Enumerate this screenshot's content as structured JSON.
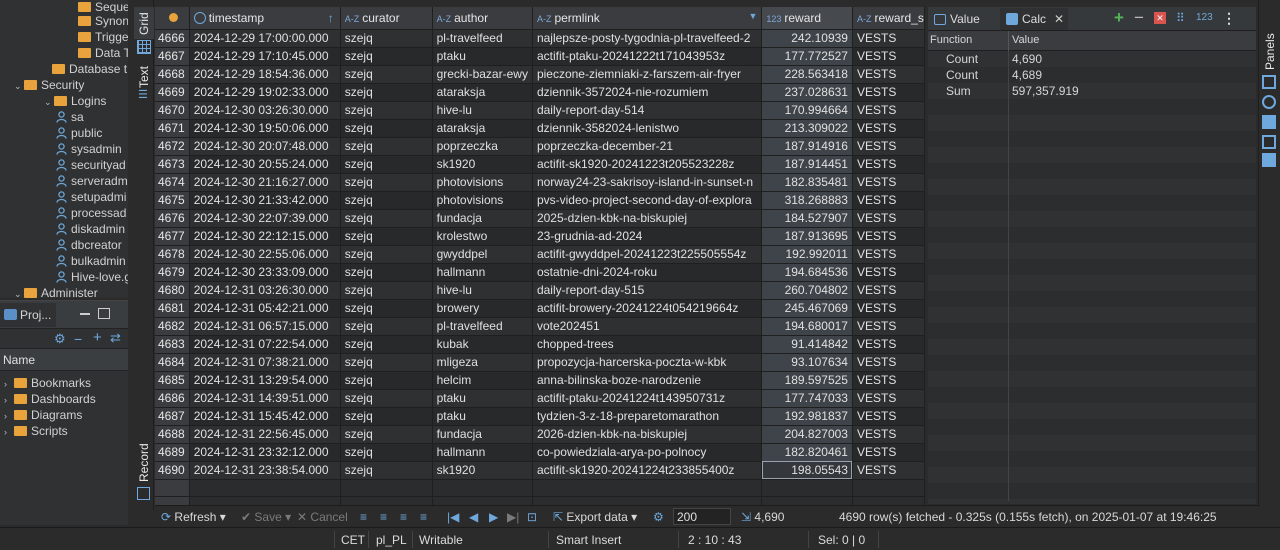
{
  "nav_tree": {
    "items": [
      {
        "label": "Seque",
        "level": 3,
        "type": "folder"
      },
      {
        "label": "Synon",
        "level": 3,
        "type": "folder"
      },
      {
        "label": "Trigge",
        "level": 3,
        "type": "folder"
      },
      {
        "label": "Data T",
        "level": 3,
        "type": "folder"
      },
      {
        "label": "Database t",
        "level": 2,
        "type": "folder"
      },
      {
        "label": "Security",
        "level": 1,
        "type": "folder",
        "expanded": true
      },
      {
        "label": "Logins",
        "level": 2,
        "type": "folder",
        "expanded": true
      },
      {
        "label": "sa",
        "level": 3,
        "type": "user"
      },
      {
        "label": "public",
        "level": 3,
        "type": "user"
      },
      {
        "label": "sysadmin",
        "level": 3,
        "type": "user"
      },
      {
        "label": "securityad",
        "level": 3,
        "type": "user"
      },
      {
        "label": "serveradm",
        "level": 3,
        "type": "user"
      },
      {
        "label": "setupadmi",
        "level": 3,
        "type": "user"
      },
      {
        "label": "processad",
        "level": 3,
        "type": "user"
      },
      {
        "label": "diskadmin",
        "level": 3,
        "type": "user"
      },
      {
        "label": "dbcreator",
        "level": 3,
        "type": "user"
      },
      {
        "label": "bulkadmin",
        "level": 3,
        "type": "user"
      },
      {
        "label": "Hive-love.g",
        "level": 3,
        "type": "user"
      },
      {
        "label": "Administer",
        "level": 1,
        "type": "folder",
        "expanded": true
      }
    ]
  },
  "projects_panel": {
    "tab_label": "Proj...",
    "column_header": "Name",
    "items": [
      "Bookmarks",
      "Dashboards",
      "Diagrams",
      "Scripts"
    ]
  },
  "view_tabs": {
    "grid": "Grid",
    "text": "Text",
    "record": "Record"
  },
  "grid": {
    "columns": [
      {
        "label": "timestamp",
        "type": "time"
      },
      {
        "label": "curator",
        "type": "A-Z"
      },
      {
        "label": "author",
        "type": "A-Z"
      },
      {
        "label": "permlink",
        "type": "A-Z"
      },
      {
        "label": "reward",
        "type": "123"
      },
      {
        "label": "reward_s",
        "type": "A-Z"
      }
    ],
    "type_tag_text": "A-Z",
    "numeric_tag_text": "123",
    "rows": [
      [
        "4666",
        "2024-12-29 17:00:00.000",
        "szejq",
        "pl-travelfeed",
        "najlepsze-posty-tygodnia-pl-travelfeed-2",
        "242.10939",
        "VESTS"
      ],
      [
        "4667",
        "2024-12-29 17:10:45.000",
        "szejq",
        "ptaku",
        "actifit-ptaku-20241222t171043953z",
        "177.772527",
        "VESTS"
      ],
      [
        "4668",
        "2024-12-29 18:54:36.000",
        "szejq",
        "grecki-bazar-ewy",
        "pieczone-ziemniaki-z-farszem-air-fryer",
        "228.563418",
        "VESTS"
      ],
      [
        "4669",
        "2024-12-29 19:02:33.000",
        "szejq",
        "ataraksja",
        "dziennik-3572024-nie-rozumiem",
        "237.028631",
        "VESTS"
      ],
      [
        "4670",
        "2024-12-30 03:26:30.000",
        "szejq",
        "hive-lu",
        "daily-report-day-514",
        "170.994664",
        "VESTS"
      ],
      [
        "4671",
        "2024-12-30 19:50:06.000",
        "szejq",
        "ataraksja",
        "dziennik-3582024-lenistwo",
        "213.309022",
        "VESTS"
      ],
      [
        "4672",
        "2024-12-30 20:07:48.000",
        "szejq",
        "poprzeczka",
        "poprzeczka-december-21",
        "187.914916",
        "VESTS"
      ],
      [
        "4673",
        "2024-12-30 20:55:24.000",
        "szejq",
        "sk1920",
        "actifit-sk1920-20241223t205523228z",
        "187.914451",
        "VESTS"
      ],
      [
        "4674",
        "2024-12-30 21:16:27.000",
        "szejq",
        "photovisions",
        "norway24-23-sakrisoy-island-in-sunset-n",
        "182.835481",
        "VESTS"
      ],
      [
        "4675",
        "2024-12-30 21:33:42.000",
        "szejq",
        "photovisions",
        "pvs-video-project-second-day-of-explora",
        "318.268883",
        "VESTS"
      ],
      [
        "4676",
        "2024-12-30 22:07:39.000",
        "szejq",
        "fundacja",
        "2025-dzien-kbk-na-biskupiej",
        "184.527907",
        "VESTS"
      ],
      [
        "4677",
        "2024-12-30 22:12:15.000",
        "szejq",
        "krolestwo",
        "23-grudnia-ad-2024",
        "187.913695",
        "VESTS"
      ],
      [
        "4678",
        "2024-12-30 22:55:06.000",
        "szejq",
        "gwyddpel",
        "actifit-gwyddpel-20241223t225505554z",
        "192.992011",
        "VESTS"
      ],
      [
        "4679",
        "2024-12-30 23:33:09.000",
        "szejq",
        "hallmann",
        "ostatnie-dni-2024-roku",
        "194.684536",
        "VESTS"
      ],
      [
        "4680",
        "2024-12-31 03:26:30.000",
        "szejq",
        "hive-lu",
        "daily-report-day-515",
        "260.704802",
        "VESTS"
      ],
      [
        "4681",
        "2024-12-31 05:42:21.000",
        "szejq",
        "browery",
        "actifit-browery-20241224t054219664z",
        "245.467069",
        "VESTS"
      ],
      [
        "4682",
        "2024-12-31 06:57:15.000",
        "szejq",
        "pl-travelfeed",
        "vote202451",
        "194.680017",
        "VESTS"
      ],
      [
        "4683",
        "2024-12-31 07:22:54.000",
        "szejq",
        "kubak",
        "chopped-trees",
        "91.414842",
        "VESTS"
      ],
      [
        "4684",
        "2024-12-31 07:38:21.000",
        "szejq",
        "mligeza",
        "propozycja-harcerska-poczta-w-kbk",
        "93.107634",
        "VESTS"
      ],
      [
        "4685",
        "2024-12-31 13:29:54.000",
        "szejq",
        "helcim",
        "anna-bilinska-boze-narodzenie",
        "189.597525",
        "VESTS"
      ],
      [
        "4686",
        "2024-12-31 14:39:51.000",
        "szejq",
        "ptaku",
        "actifit-ptaku-20241224t143950731z",
        "177.747033",
        "VESTS"
      ],
      [
        "4687",
        "2024-12-31 15:45:42.000",
        "szejq",
        "ptaku",
        "tydzien-3-z-18-preparetomarathon",
        "192.981837",
        "VESTS"
      ],
      [
        "4688",
        "2024-12-31 22:56:45.000",
        "szejq",
        "fundacja",
        "2026-dzien-kbk-na-biskupiej",
        "204.827003",
        "VESTS"
      ],
      [
        "4689",
        "2024-12-31 23:32:12.000",
        "szejq",
        "hallmann",
        "co-powiedziala-arya-po-polnocy",
        "182.820461",
        "VESTS"
      ],
      [
        "4690",
        "2024-12-31 23:38:54.000",
        "szejq",
        "sk1920",
        "actifit-sk1920-20241224t233855400z",
        "198.05543",
        "VESTS"
      ]
    ]
  },
  "toolbar": {
    "refresh": "Refresh",
    "save": "Save",
    "cancel": "Cancel",
    "export": "Export data",
    "fetch_size": "200",
    "row_count": "4,690",
    "status": "4690 row(s) fetched - 0.325s (0.155s fetch), on 2025-01-07 at 19:46:25"
  },
  "calc_panel": {
    "tabs": {
      "value": "Value",
      "calc": "Calc"
    },
    "number_tag": "123",
    "headers": {
      "function": "Function",
      "value": "Value"
    },
    "rows": [
      {
        "function": "Count",
        "value": "4,690"
      },
      {
        "function": "Count Distin",
        "value": "4,689"
      },
      {
        "function": "Sum",
        "value": "597,357.919"
      }
    ]
  },
  "panels_label": "Panels",
  "statusbar": {
    "timezone": "CET",
    "locale": "pl_PL",
    "mode": "Writable",
    "insert": "Smart Insert",
    "position": "2 : 10 : 43",
    "selection": "Sel: 0 | 0"
  },
  "colors": {
    "folder": "#e8a33c",
    "user": "#6fa8dc",
    "accent": "#4a88c7",
    "add": "#56b35a",
    "delete": "#d9534f"
  }
}
